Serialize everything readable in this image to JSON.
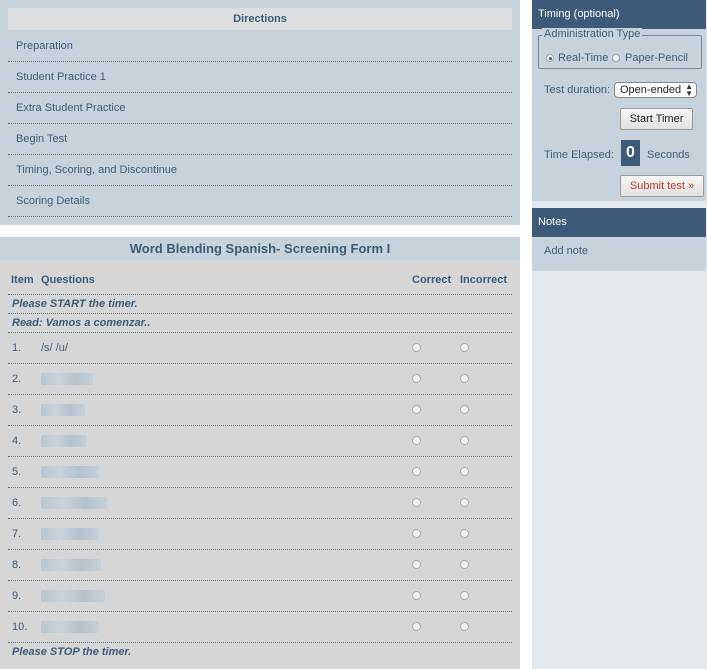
{
  "directions": {
    "title": "Directions",
    "items": [
      "Preparation",
      "Student Practice 1",
      "Extra Student Practice",
      "Begin Test",
      "Timing, Scoring, and Discontinue",
      "Scoring Details"
    ]
  },
  "test": {
    "title": "Word Blending Spanish- Screening Form I",
    "columns": {
      "item": "Item",
      "questions": "Questions",
      "correct": "Correct",
      "incorrect": "Incorrect"
    },
    "instructions_top": [
      "Please START the timer.",
      "Read: Vamos a comenzar.."
    ],
    "instruction_bottom": "Please STOP the timer.",
    "rows": [
      {
        "num": "1.",
        "text": "/s/ /u/"
      },
      {
        "num": "2.",
        "text": ""
      },
      {
        "num": "3.",
        "text": ""
      },
      {
        "num": "4.",
        "text": ""
      },
      {
        "num": "5.",
        "text": ""
      },
      {
        "num": "6.",
        "text": ""
      },
      {
        "num": "7.",
        "text": ""
      },
      {
        "num": "8.",
        "text": ""
      },
      {
        "num": "9.",
        "text": ""
      },
      {
        "num": "10.",
        "text": ""
      }
    ]
  },
  "timing": {
    "title": "Timing (optional)",
    "admin_type_legend": "Administration Type",
    "admin_options": [
      "Real-Time",
      "Paper-Pencil"
    ],
    "selected_admin": "Real-Time",
    "duration_label": "Test duration:",
    "duration_value": "Open-ended",
    "start_button": "Start Timer",
    "elapsed_label": "Time Elapsed:",
    "elapsed_value": "0",
    "seconds_label": "Seconds",
    "submit_button": "Submit test »"
  },
  "notes": {
    "title": "Notes",
    "add_note": "Add note"
  },
  "colors": {
    "header_blue": "#3d5b78",
    "panel_blue": "#c6d3dd",
    "submit_red": "#c0392b"
  }
}
